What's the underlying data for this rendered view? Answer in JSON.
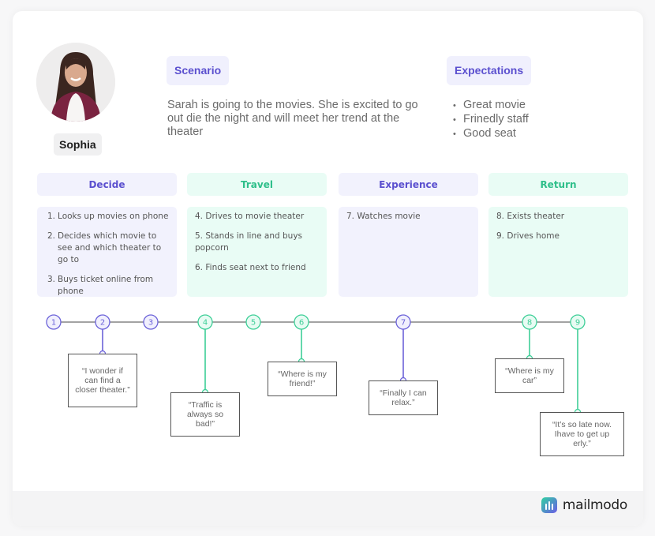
{
  "persona": {
    "name": "Sophia",
    "avatar_icon": "person-photo"
  },
  "scenario": {
    "label": "Scenario",
    "text": "Sarah is going to the movies. She is excited to go out die the night and will meet her trend at the theater"
  },
  "expectations": {
    "label": "Expectations",
    "items": [
      "Great movie",
      "Frinedly staff",
      "Good seat"
    ]
  },
  "stages": [
    {
      "title": "Decide",
      "theme": "purple",
      "steps": [
        {
          "num": "1.",
          "text": "Looks up movies on phone"
        },
        {
          "num": "2.",
          "text": "Decides which movie to see and which theater to go to"
        },
        {
          "num": "3.",
          "text": "Buys ticket online from phone"
        }
      ]
    },
    {
      "title": "Travel",
      "theme": "green",
      "steps": [
        {
          "num": "4.",
          "text": "Drives to movie theater"
        },
        {
          "num": "5.",
          "text": "Stands in line and buys popcorn"
        },
        {
          "num": "6.",
          "text": "Finds seat next to friend"
        }
      ]
    },
    {
      "title": "Experience",
      "theme": "purple",
      "steps": [
        {
          "num": "7.",
          "text": "Watches movie"
        }
      ]
    },
    {
      "title": "Return",
      "theme": "green",
      "steps": [
        {
          "num": "8.",
          "text": "Exists theater"
        },
        {
          "num": "9.",
          "text": "Drives home"
        }
      ]
    }
  ],
  "timeline": {
    "nodes": [
      {
        "label": "1",
        "theme": "purple"
      },
      {
        "label": "2",
        "theme": "purple"
      },
      {
        "label": "3",
        "theme": "purple"
      },
      {
        "label": "4",
        "theme": "green"
      },
      {
        "label": "5",
        "theme": "green"
      },
      {
        "label": "6",
        "theme": "green"
      },
      {
        "label": "7",
        "theme": "purple"
      },
      {
        "label": "8",
        "theme": "green"
      },
      {
        "label": "9",
        "theme": "green"
      }
    ],
    "quotes": [
      {
        "node": "2",
        "text": "“I wonder if can find a closer theater.”"
      },
      {
        "node": "4",
        "text": "“Traffic is always so bad!”"
      },
      {
        "node": "6",
        "text": "“Where is my friend!”"
      },
      {
        "node": "7",
        "text": "“Finally I can relax.”"
      },
      {
        "node": "8",
        "text": "“Where is my car”"
      },
      {
        "node": "9",
        "text": "“It’s so late now. Ihave to get up erly.”"
      }
    ]
  },
  "colors": {
    "purple": "#6c63d9",
    "purple_fill": "#f1f0fd",
    "green": "#3ecf98",
    "green_fill": "#e8fbf3",
    "line": "#a3a3a3"
  },
  "brand": {
    "name": "mailmodo",
    "icon": "mailmodo-logo-icon"
  }
}
